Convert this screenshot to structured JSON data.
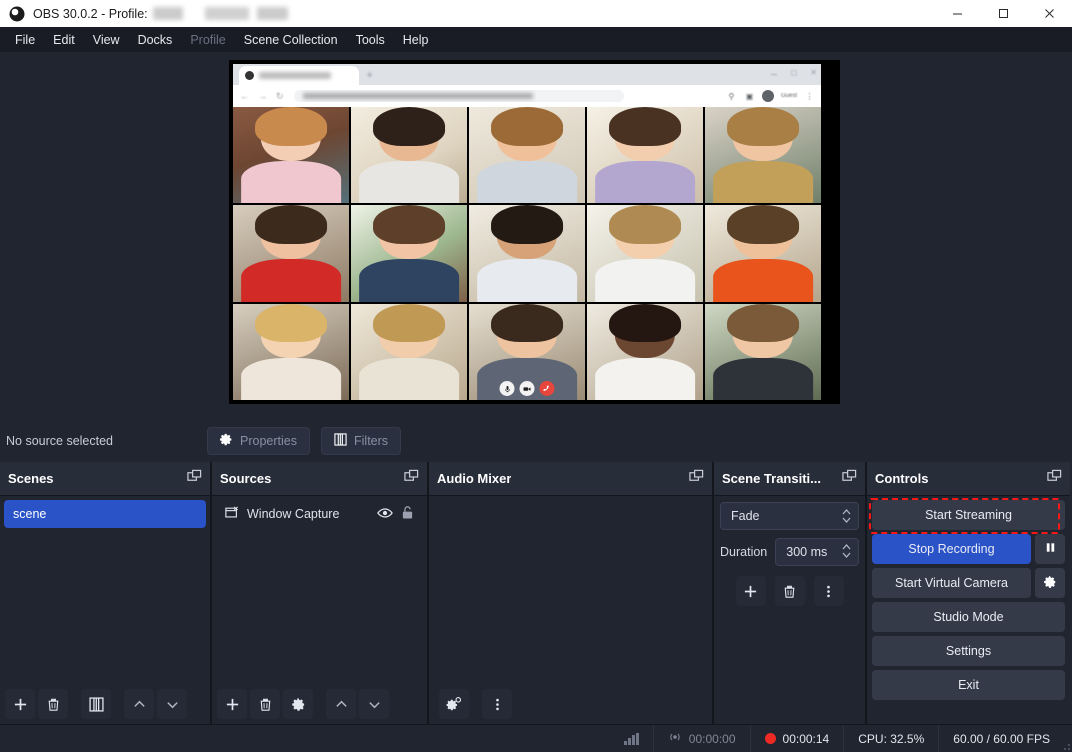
{
  "titlebar": {
    "app_title": "OBS 30.0.2 - Profile:",
    "profile_redacted": "",
    "minimize": "─",
    "maximize": "□",
    "close": "✕",
    "icon": "obs-logo-icon"
  },
  "menubar": {
    "items": [
      {
        "label": "File",
        "disabled": false
      },
      {
        "label": "Edit",
        "disabled": false
      },
      {
        "label": "View",
        "disabled": false
      },
      {
        "label": "Docks",
        "disabled": false
      },
      {
        "label": "Profile",
        "disabled": true
      },
      {
        "label": "Scene Collection",
        "disabled": false
      },
      {
        "label": "Tools",
        "disabled": false
      },
      {
        "label": "Help",
        "disabled": false
      }
    ]
  },
  "preview": {
    "browser": {
      "tab_title_redacted": "",
      "address_redacted": "",
      "guest_label": "Guest"
    },
    "video_grid": {
      "columns": 5,
      "rows": 3,
      "participants": 15
    },
    "call_controls": {
      "mic": "microphone-icon",
      "camera": "camera-icon",
      "hangup": "hangup-icon"
    }
  },
  "source_toolbar": {
    "status": "No source selected",
    "properties_label": "Properties",
    "filters_label": "Filters"
  },
  "docks": {
    "scenes": {
      "title": "Scenes",
      "items": [
        {
          "name": "scene",
          "selected": true
        }
      ],
      "toolbar": [
        "add-scene",
        "remove-scene",
        "scene-filters",
        "move-scene-up",
        "move-scene-down"
      ]
    },
    "sources": {
      "title": "Sources",
      "items": [
        {
          "name": "Window Capture",
          "visible": true,
          "locked": false
        }
      ],
      "toolbar": [
        "add-source",
        "remove-source",
        "source-properties",
        "move-source-up",
        "move-source-down"
      ]
    },
    "audio_mixer": {
      "title": "Audio Mixer",
      "channels": [],
      "toolbar": [
        "audio-advanced-properties",
        "audio-menu"
      ]
    },
    "scene_transitions": {
      "title": "Scene Transiti...",
      "transition": "Fade",
      "duration_label": "Duration",
      "duration_value": "300 ms",
      "toolbar": [
        "add-transition",
        "remove-transition",
        "transition-menu"
      ]
    },
    "controls": {
      "title": "Controls",
      "start_streaming": "Start Streaming",
      "stop_recording": "Stop Recording",
      "pause_recording": "pause-icon",
      "start_virtual_camera": "Start Virtual Camera",
      "virtual_camera_settings": "gear-icon",
      "studio_mode": "Studio Mode",
      "settings": "Settings",
      "exit": "Exit",
      "highlight_color": "#ff1717",
      "recording_active_color": "#2a53c8"
    }
  },
  "statusbar": {
    "signal_icon": "signal-bars-icon",
    "stream_icon": "broadcast-icon",
    "stream_time": "00:00:00",
    "record_icon": "record-dot-icon",
    "record_time": "00:00:14",
    "cpu": "CPU: 32.5%",
    "fps": "60.00 / 60.00 FPS"
  }
}
